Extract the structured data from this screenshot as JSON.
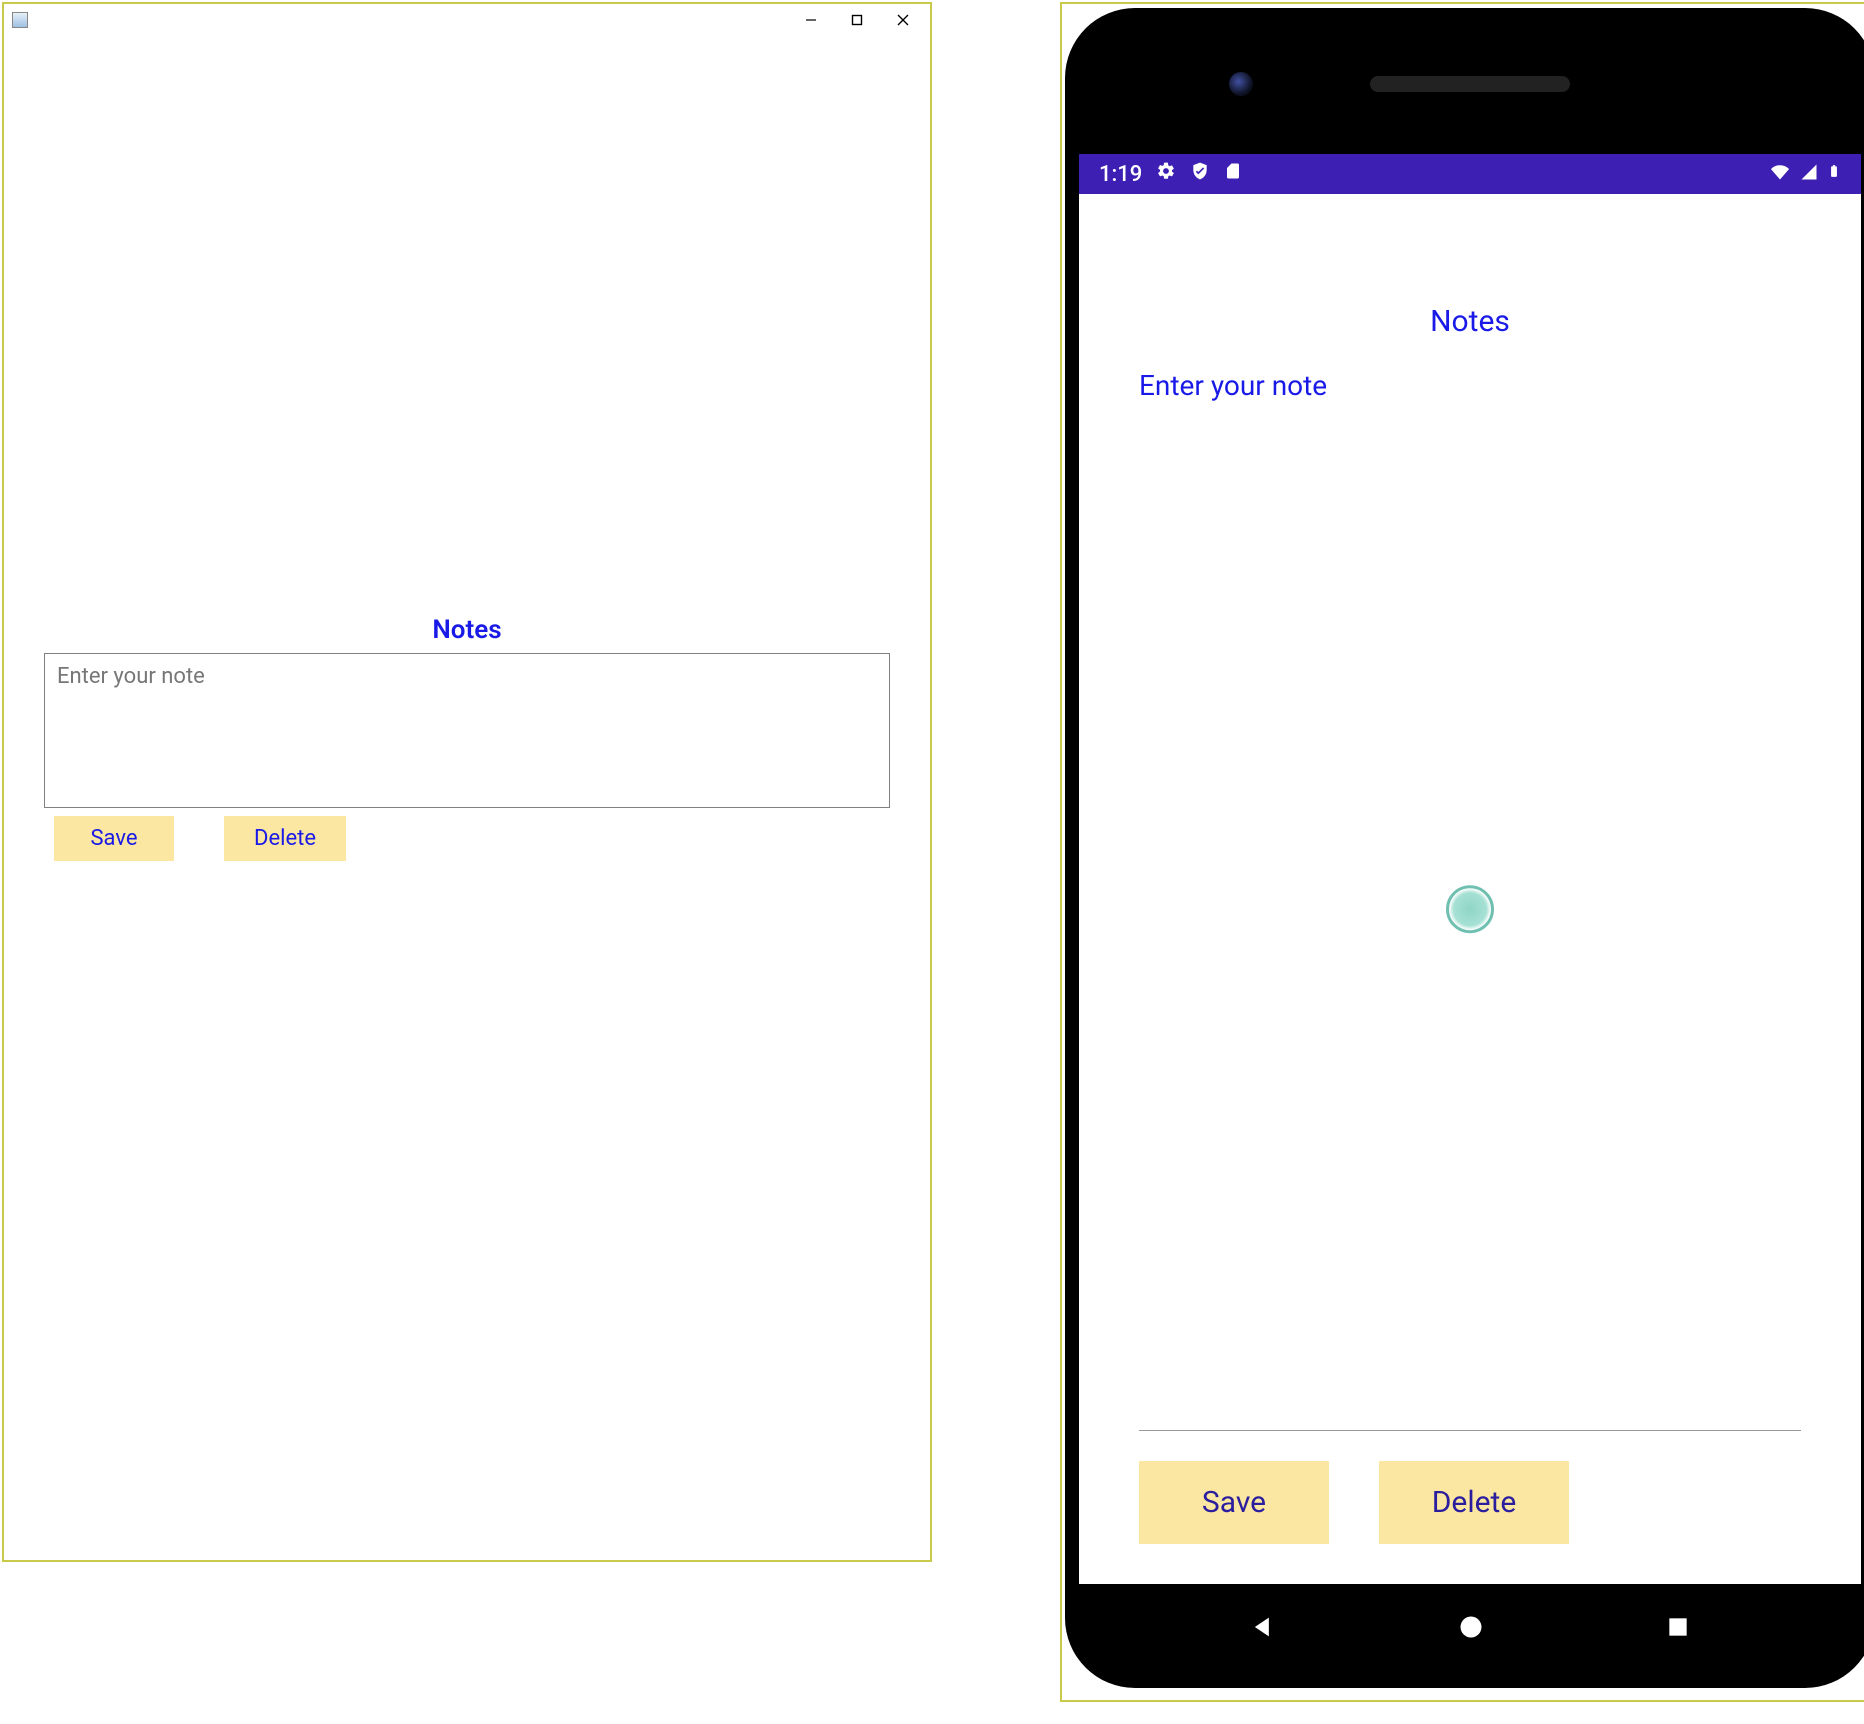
{
  "desktop": {
    "heading": "Notes",
    "placeholder": "Enter your note",
    "save_label": "Save",
    "delete_label": "Delete"
  },
  "phone": {
    "status_time": "1:19",
    "heading": "Notes",
    "hint": "Enter your note",
    "save_label": "Save",
    "delete_label": "Delete"
  },
  "colors": {
    "accent": "#1a1ae8",
    "button_bg": "#fbe6a2",
    "status_bar": "#3e1fb3",
    "highlight_border": "#caca4a"
  }
}
